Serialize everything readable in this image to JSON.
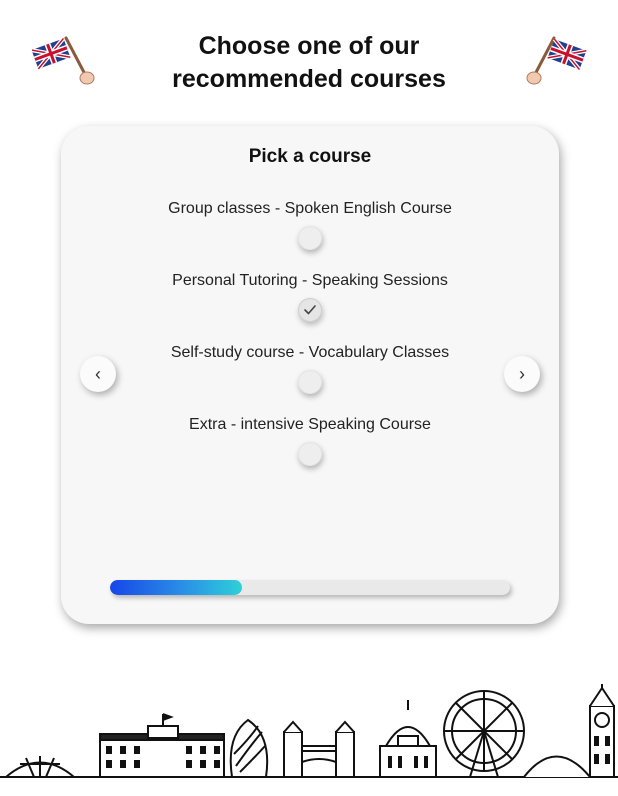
{
  "page": {
    "title": "Choose one of our recommended courses"
  },
  "card": {
    "title": "Pick a course",
    "options": [
      {
        "label": "Group classes - Spoken English Course",
        "checked": false
      },
      {
        "label": "Personal Tutoring - Speaking Sessions",
        "checked": true
      },
      {
        "label": "Self-study course - Vocabulary Classes",
        "checked": false
      },
      {
        "label": "Extra - intensive Speaking Course",
        "checked": false
      }
    ],
    "prev_glyph": "‹",
    "next_glyph": "›",
    "progress_fraction": 0.33
  },
  "icons": {
    "flag": "uk-flag-icon",
    "check": "checkmark-icon",
    "skyline": "london-skyline-illustration"
  },
  "colors": {
    "progress_start": "#1746e8",
    "progress_end": "#2ed0d8",
    "card_bg": "#f7f7f7"
  }
}
